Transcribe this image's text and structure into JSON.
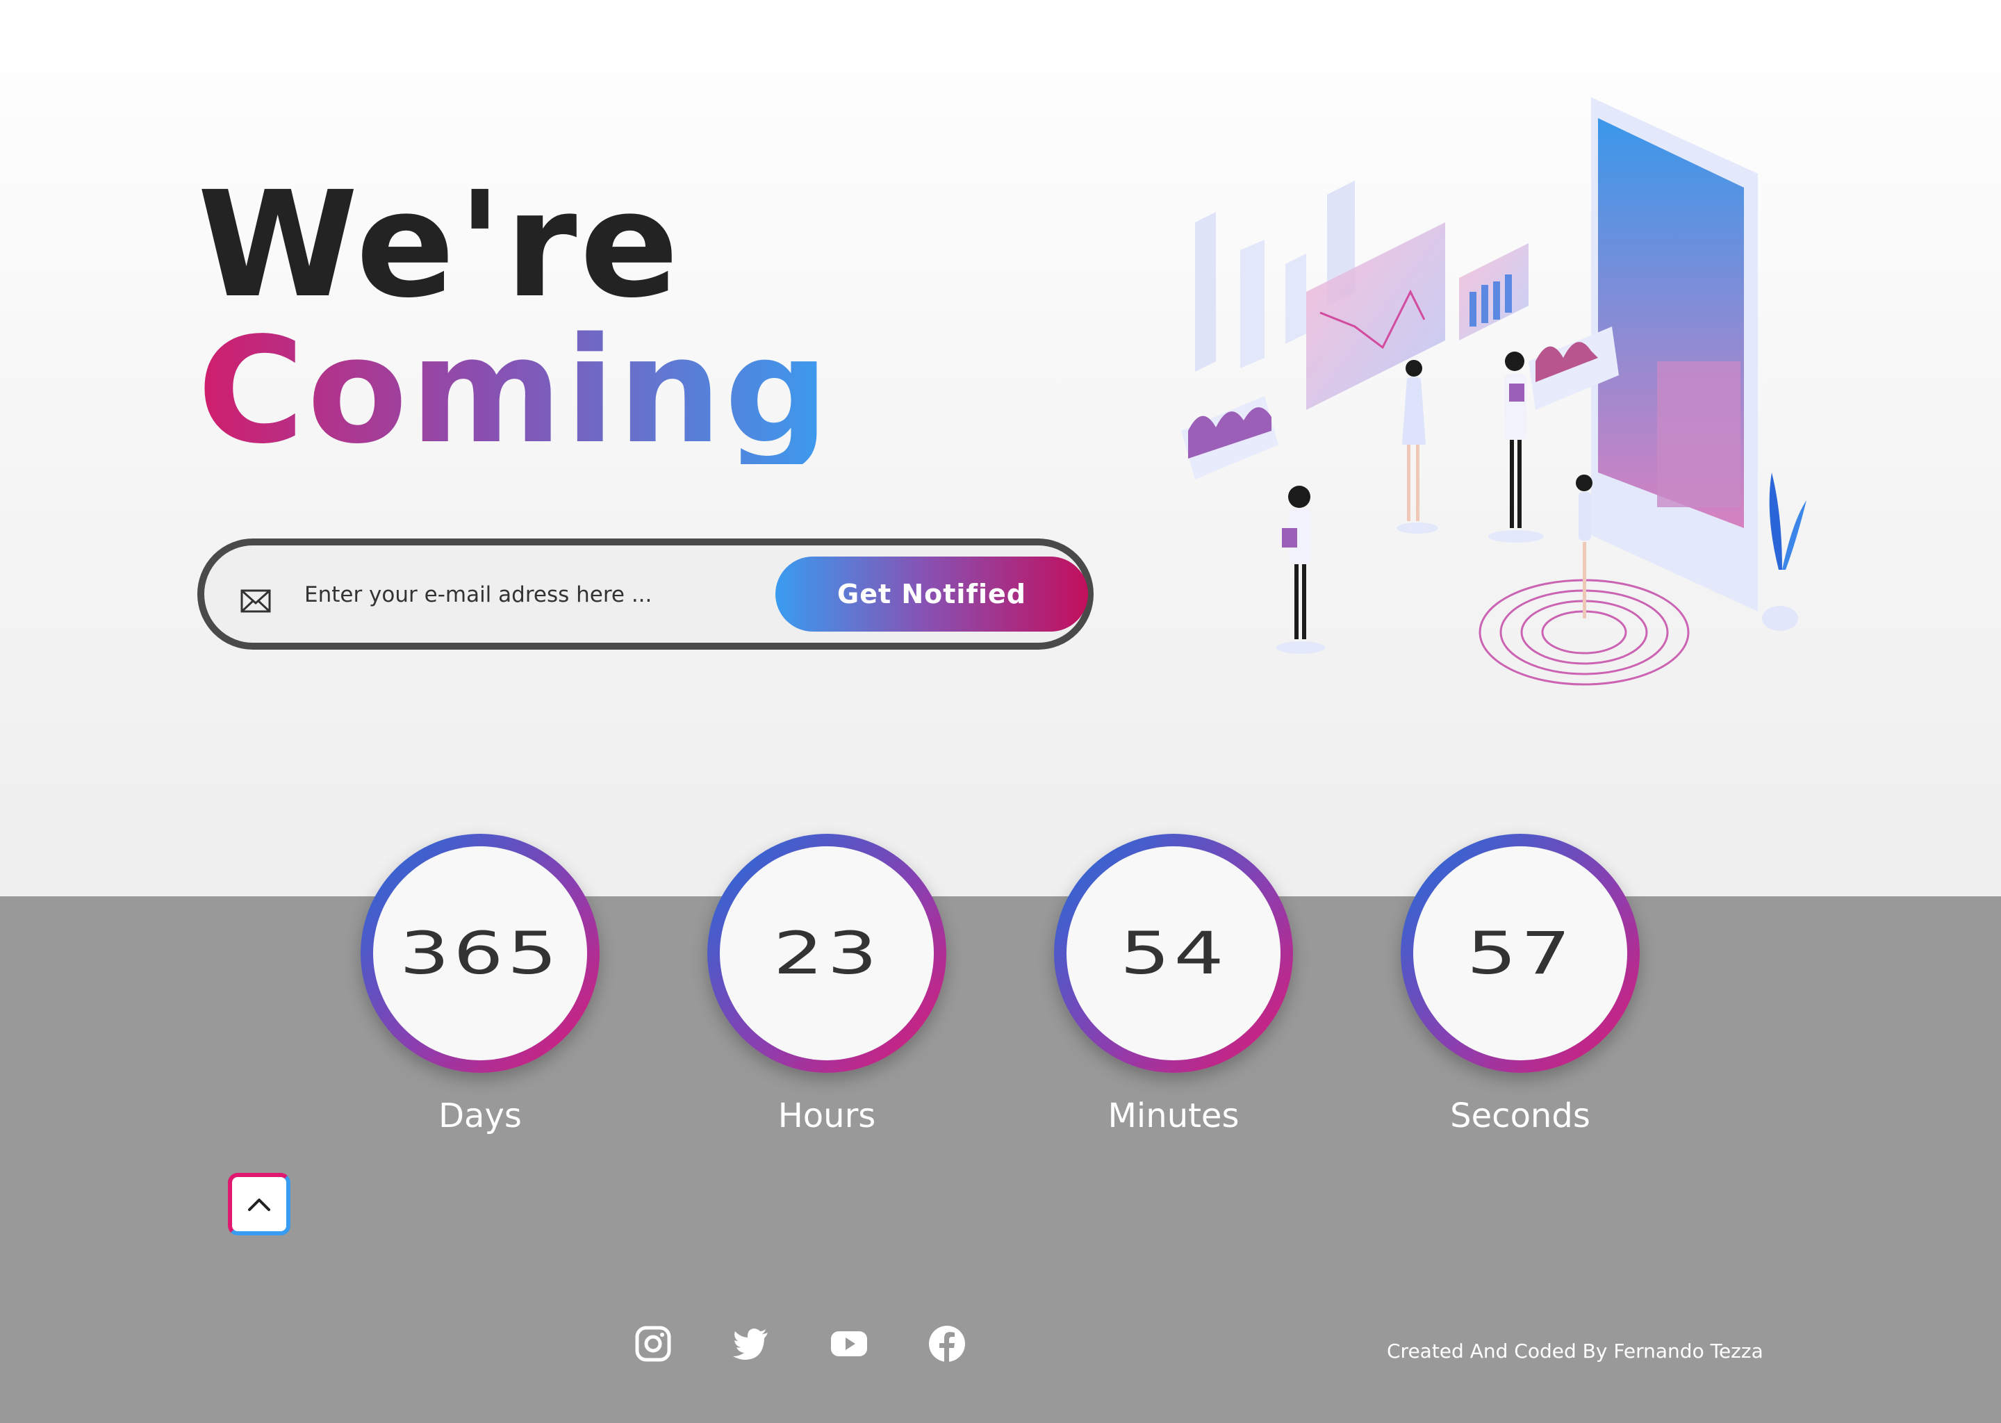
{
  "hero": {
    "title_line1": "We're",
    "title_line2": "Coming"
  },
  "signup": {
    "email_placeholder": "Enter your e-mail adress here ...",
    "button_label": "Get Notified",
    "icon": "envelope-icon"
  },
  "countdown": [
    {
      "value": "365",
      "label": "Days"
    },
    {
      "value": "23",
      "label": "Hours"
    },
    {
      "value": "54",
      "label": "Minutes"
    },
    {
      "value": "57",
      "label": "Seconds"
    }
  ],
  "scroll_top": {
    "icon": "chevron-up-icon"
  },
  "footer": {
    "socials": [
      "instagram-icon",
      "twitter-icon",
      "youtube-icon",
      "facebook-icon"
    ],
    "credit": "Created And Coded By Fernando Tezza"
  },
  "colors": {
    "accent_pink": "#d11d6c",
    "accent_purple": "#8a4fb0",
    "accent_blue": "#3a9cf0",
    "footer_bg": "#999999",
    "title_dark": "#232323"
  }
}
